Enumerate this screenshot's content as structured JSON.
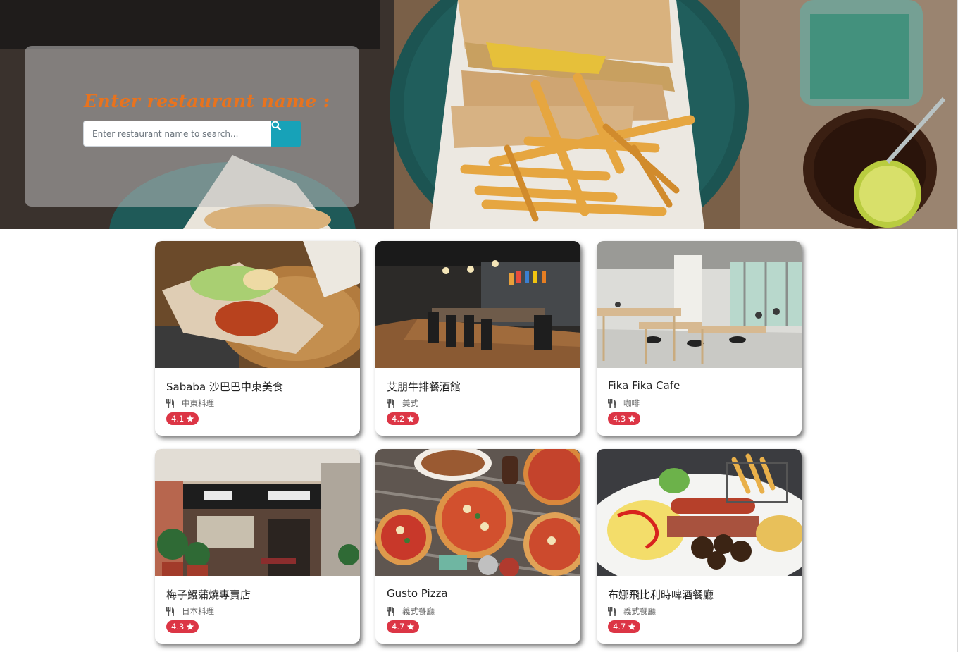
{
  "search": {
    "title": "Enter restaurant name :",
    "placeholder": "Enter restaurant name to search...",
    "button_icon": "search-icon"
  },
  "restaurants": [
    {
      "name": "Sababa 沙巴巴中東美食",
      "category": "中東料理",
      "rating": "4.1",
      "category_icon": "utensils-icon",
      "rating_icon": "star-icon"
    },
    {
      "name": "艾朋牛排餐酒館",
      "category": "美式",
      "rating": "4.2",
      "category_icon": "utensils-icon",
      "rating_icon": "star-icon"
    },
    {
      "name": "Fika Fika Cafe",
      "category": "咖啡",
      "rating": "4.3",
      "category_icon": "utensils-icon",
      "rating_icon": "star-icon"
    },
    {
      "name": "梅子鰻蒲燒專賣店",
      "category": "日本料理",
      "rating": "4.3",
      "category_icon": "utensils-icon",
      "rating_icon": "star-icon"
    },
    {
      "name": "Gusto Pizza",
      "category": "義式餐廳",
      "rating": "4.7",
      "category_icon": "utensils-icon",
      "rating_icon": "star-icon"
    },
    {
      "name": "布娜飛比利時啤酒餐廳",
      "category": "義式餐廳",
      "rating": "4.7",
      "category_icon": "utensils-icon",
      "rating_icon": "star-icon"
    }
  ],
  "colors": {
    "title_orange": "#e8731e",
    "search_button": "#17a2b8",
    "rating_badge": "#dc3545"
  }
}
